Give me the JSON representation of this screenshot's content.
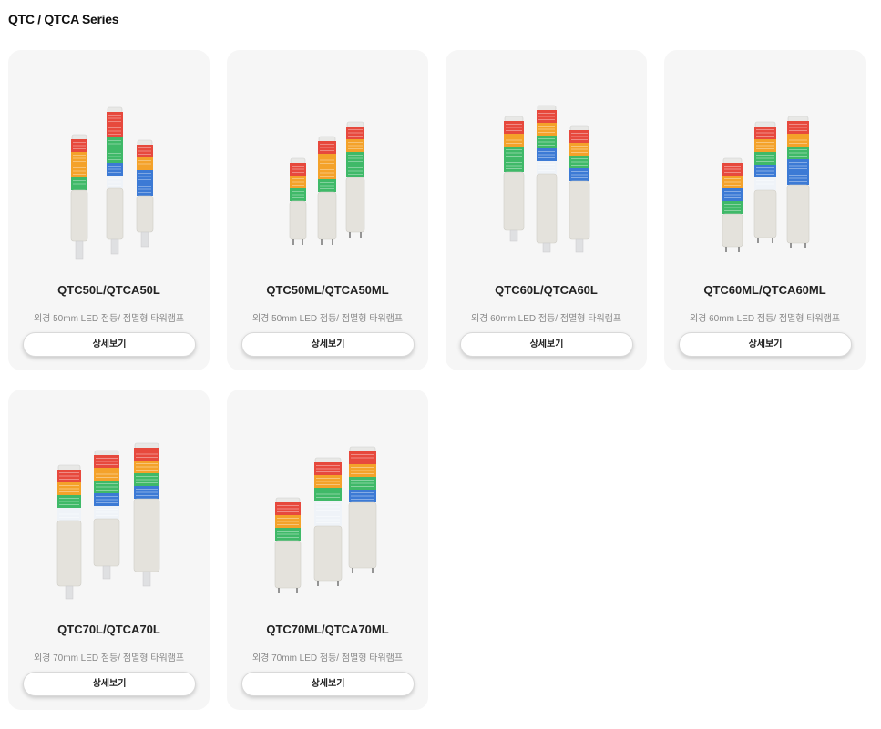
{
  "page": {
    "title": "QTC / QTCA Series"
  },
  "products": [
    {
      "name": "QTC50L/QTCA50L",
      "description": "외경 50mm LED 점등/ 점멸형 타워램프",
      "button": "상세보기",
      "image": "tower-lamp-image"
    },
    {
      "name": "QTC50ML/QTCA50ML",
      "description": "외경 50mm LED 점등/ 점멸형 타워램프",
      "button": "상세보기",
      "image": "tower-lamp-image"
    },
    {
      "name": "QTC60L/QTCA60L",
      "description": "외경 60mm LED 점등/ 점멸형 타워램프",
      "button": "상세보기",
      "image": "tower-lamp-image"
    },
    {
      "name": "QTC60ML/QTCA60ML",
      "description": "외경 60mm LED 점등/ 점멸형 타워램프",
      "button": "상세보기",
      "image": "tower-lamp-image"
    },
    {
      "name": "QTC70L/QTCA70L",
      "description": "외경 70mm LED 점등/ 점멸형 타워램프",
      "button": "상세보기",
      "image": "tower-lamp-image"
    },
    {
      "name": "QTC70ML/QTCA70ML",
      "description": "외경 70mm LED 점등/ 점멸형 타워램프",
      "button": "상세보기",
      "image": "tower-lamp-image"
    }
  ],
  "colors": {
    "red": "#e53a2c",
    "orange": "#f39a18",
    "green": "#2fb35b",
    "blue": "#2b6fd1",
    "white": "#eef2f7",
    "body": "#e4e2dc",
    "card_bg": "#f6f6f6"
  }
}
